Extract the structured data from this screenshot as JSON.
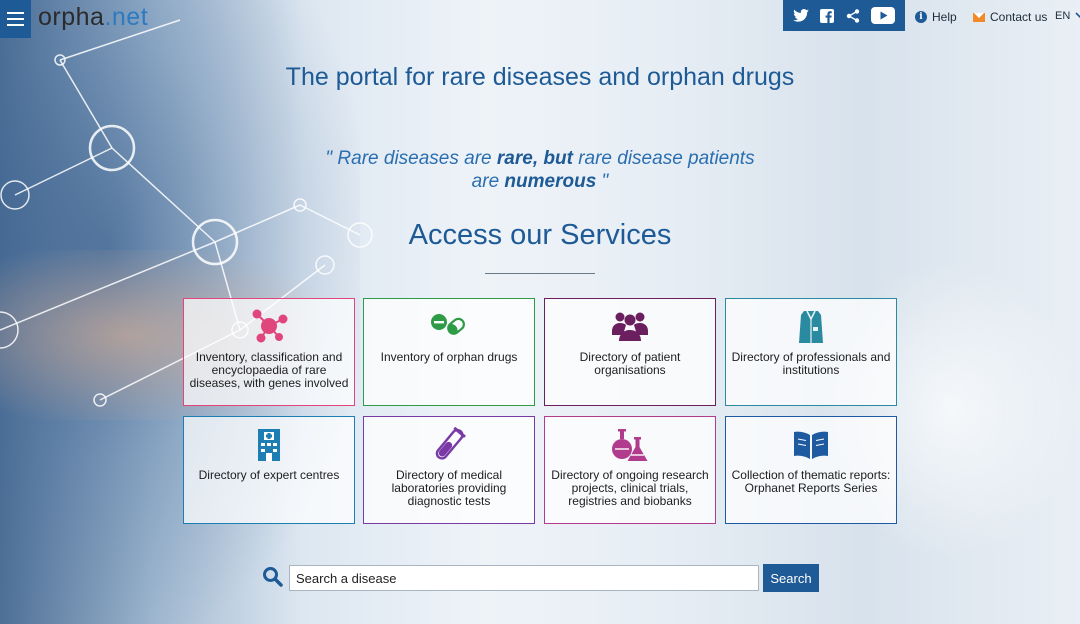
{
  "header": {
    "logo_main": "orpha",
    "logo_dot": ".",
    "logo_tail": "net",
    "help_label": "Help",
    "contact_label": "Contact us",
    "language": "EN",
    "social_icons": [
      "twitter-icon",
      "facebook-icon",
      "share-icon",
      "youtube-icon"
    ]
  },
  "hero": {
    "headline": "The portal for rare diseases and orphan drugs",
    "quote_open": "\" Rare diseases are ",
    "quote_bold1": "rare, but",
    "quote_mid": " rare disease patients are ",
    "quote_bold2": "numerous",
    "quote_close": " \""
  },
  "services": {
    "title": "Access our Services",
    "cards": [
      {
        "label": "Inventory, classification and encyclopaedia of rare diseases, with genes involved",
        "icon": "molecule-icon",
        "color": "#e0457b"
      },
      {
        "label": "Inventory of orphan drugs",
        "icon": "pills-icon",
        "color": "#2e9b47"
      },
      {
        "label": "Directory of patient organisations",
        "icon": "people-group-icon",
        "color": "#6b1f5e"
      },
      {
        "label": "Directory of professionals and institutions",
        "icon": "lab-coat-icon",
        "color": "#2a8aa0"
      },
      {
        "label": "Directory of expert centres",
        "icon": "hospital-icon",
        "color": "#1d7eb3"
      },
      {
        "label": "Directory of medical laboratories providing diagnostic tests",
        "icon": "test-tube-icon",
        "color": "#7a3aa6"
      },
      {
        "label": "Directory of ongoing research projects, clinical trials, registries and biobanks",
        "icon": "flasks-icon",
        "color": "#b13b8c"
      },
      {
        "label": "Collection of thematic reports: Orphanet Reports Series",
        "icon": "open-book-icon",
        "color": "#1e5aa0"
      }
    ]
  },
  "search": {
    "placeholder": "Search a disease",
    "button_label": "Search"
  }
}
